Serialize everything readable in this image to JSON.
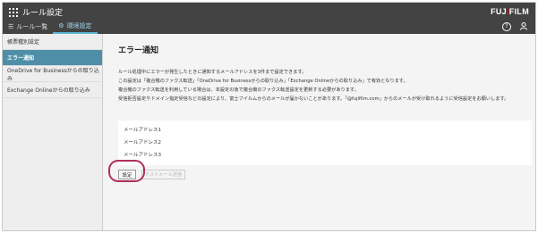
{
  "header": {
    "app_title": "ルール設定",
    "brand_prefix": "FUJ",
    "brand_i": "I",
    "brand_suffix": "FILM",
    "tabs": [
      {
        "label": "ルール一覧",
        "icon": "list-icon"
      },
      {
        "label": "環境設定",
        "icon": "gear-icon"
      }
    ],
    "icons": [
      "grid-menu-icon",
      "help-icon",
      "user-icon"
    ],
    "help_glyph": "?"
  },
  "sidebar": {
    "items": [
      {
        "label": "帳票種別設定"
      },
      {
        "label": "エラー通知"
      },
      {
        "label": "OneDrive for Businessからの取り込み"
      },
      {
        "label": "Exchange Onlineからの取り込み"
      }
    ]
  },
  "main": {
    "title": "エラー通知",
    "description": [
      "ルール処理中にエラーが発生したときに通知するメールアドレスを3件まで設定できます。",
      "この設定は「複合機のファクス転送」「OneDrive for Businessからの取り込み」「Exchange Onlineからの取り込み」で有効となります。",
      "複合機のファクス転送を利用している場合は、本設定の後で複合機のファクス転送設定を更新する必要があります。",
      "受信拒否設定やドメイン指定受信などの設定により、富士フイルムからのメールが届かないことがあります。「@fujifilm.com」からのメールが受け取れるように受信設定をお願いします。"
    ],
    "addresses": [
      {
        "label": "メールアドレス1"
      },
      {
        "label": "メールアドレス2"
      },
      {
        "label": "メールアドレス3"
      }
    ],
    "set_button": "設定",
    "test_button": "テストメール送信"
  },
  "colors": {
    "header_bg": "#434343",
    "accent": "#5bb8d6",
    "sidebar_active": "#4e8fa7",
    "highlight_ring": "#b0305a",
    "brand_red": "#e60012"
  }
}
